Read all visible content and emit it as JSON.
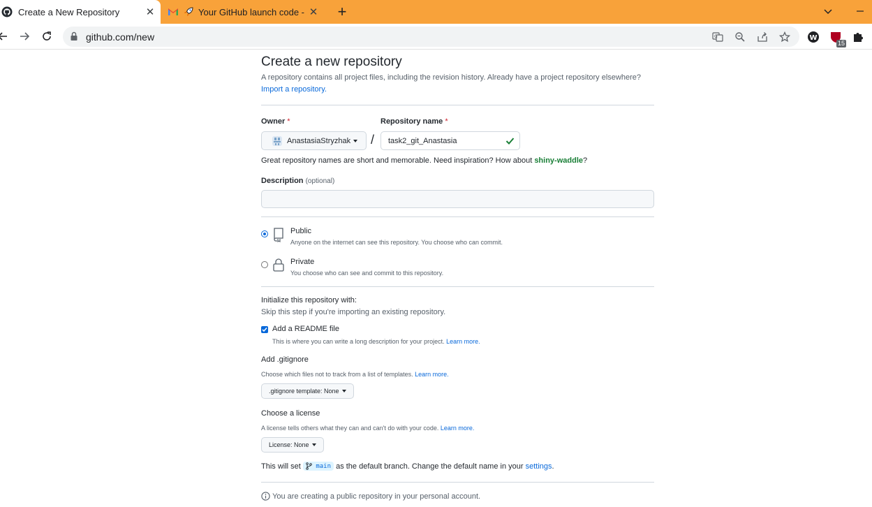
{
  "browser": {
    "tabs": [
      {
        "title": "Create a New Repository",
        "active": true
      },
      {
        "title": "Your GitHub launch code - ar",
        "active": false
      }
    ],
    "url": "github.com/new",
    "extension_badge": "15"
  },
  "page": {
    "title": "Create a new repository",
    "subtitle": "A repository contains all project files, including the revision history. Already have a project repository elsewhere?",
    "import_link": "Import a repository.",
    "owner_label": "Owner",
    "repo_name_label": "Repository name",
    "required_marker": "*",
    "owner_value": "AnastasiaStryzhak",
    "slash": "/",
    "repo_name_value": "task2_git_Anastasia",
    "hint_prefix": "Great repository names are short and memorable. Need inspiration? How about ",
    "hint_suggestion": "shiny-waddle",
    "hint_suffix": "?",
    "description_label": "Description",
    "description_optional": "(optional)",
    "description_value": "",
    "visibility": {
      "public_title": "Public",
      "public_desc": "Anyone on the internet can see this repository. You choose who can commit.",
      "private_title": "Private",
      "private_desc": "You choose who can see and commit to this repository.",
      "selected": "public"
    },
    "init_title": "Initialize this repository with:",
    "init_subtitle": "Skip this step if you're importing an existing repository.",
    "readme_label": "Add a README file",
    "readme_desc": "This is where you can write a long description for your project.",
    "readme_checked": true,
    "learn_more": "Learn more.",
    "gitignore_title": "Add .gitignore",
    "gitignore_desc": "Choose which files not to track from a list of templates.",
    "gitignore_select": ".gitignore template: None",
    "license_title": "Choose a license",
    "license_desc": "A license tells others what they can and can't do with your code.",
    "license_select": "License: None",
    "branch_prefix": "This will set",
    "branch_name": "main",
    "branch_middle": "as the default branch. Change the default name in your",
    "branch_link": "settings",
    "branch_suffix": ".",
    "info_text": "You are creating a public repository in your personal account."
  }
}
